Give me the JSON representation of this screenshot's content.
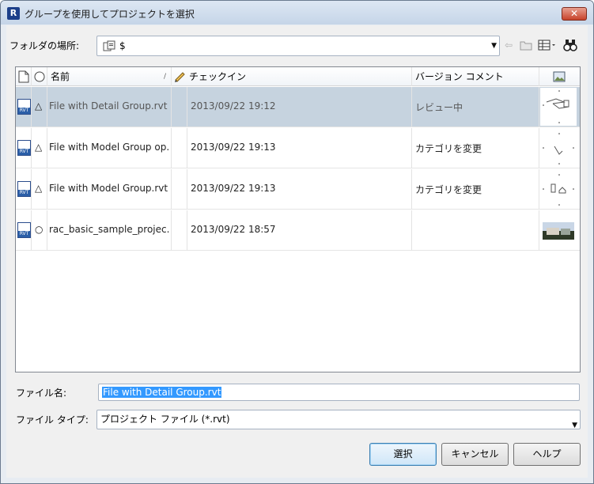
{
  "window": {
    "title": "グループを使用してプロジェクトを選択",
    "close_glyph": "✕"
  },
  "folder": {
    "label": "フォルダの場所:",
    "path": "$"
  },
  "toolbar": [
    "back-icon",
    "up-folder-icon",
    "views-icon",
    "search-icon"
  ],
  "columns": {
    "name": "名前",
    "checkin": "チェックイン",
    "comment": "バージョン コメント"
  },
  "files": [
    {
      "name": "File with Detail Group.rvt",
      "checkin": "2013/09/22 19:12",
      "comment": "レビュー中",
      "status": "△",
      "selected": true
    },
    {
      "name": "File with Model Group op...",
      "checkin": "2013/09/22 19:13",
      "comment": "カテゴリを変更",
      "status": "△",
      "selected": false
    },
    {
      "name": "File with Model Group.rvt",
      "checkin": "2013/09/22 19:13",
      "comment": "カテゴリを変更",
      "status": "△",
      "selected": false
    },
    {
      "name": "rac_basic_sample_projec...",
      "checkin": "2013/09/22 18:57",
      "comment": "",
      "status": "○",
      "selected": false
    }
  ],
  "filename": {
    "label": "ファイル名:",
    "value": "File with Detail Group.rvt"
  },
  "filetype": {
    "label": "ファイル タイプ:",
    "value": "プロジェクト ファイル (*.rvt)"
  },
  "buttons": {
    "select": "選択",
    "cancel": "キャンセル",
    "help": "ヘルプ"
  },
  "colors": {
    "selected_row": "#c6d3df",
    "selection_highlight": "#3399ff"
  }
}
